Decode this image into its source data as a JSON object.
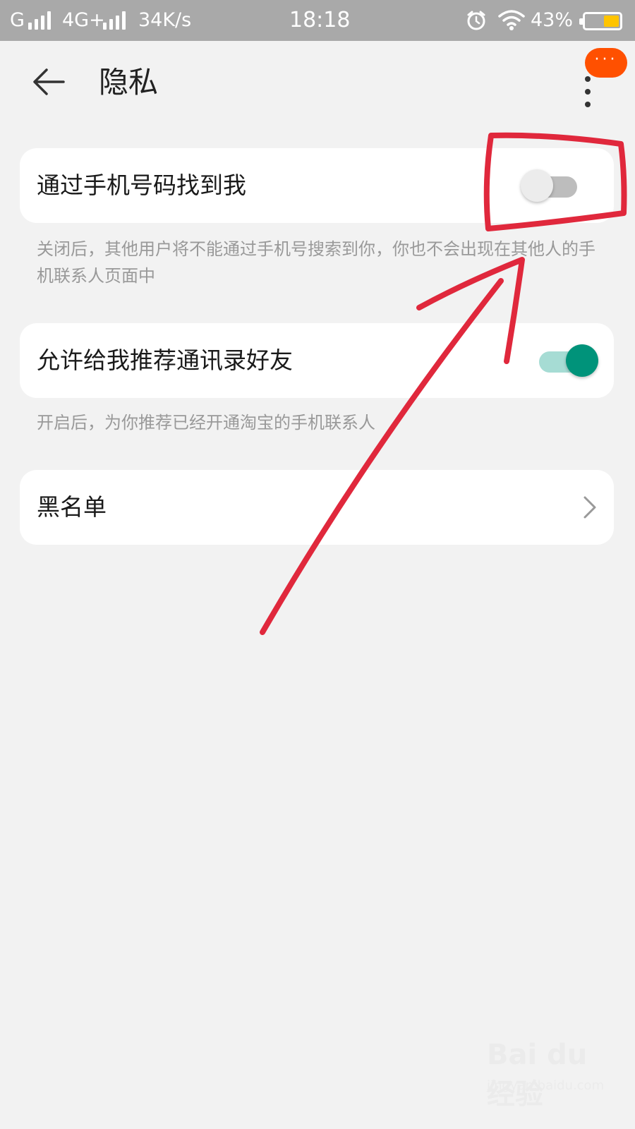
{
  "status_bar": {
    "carrier1": "G",
    "carrier2": "4G+",
    "speed": "34K/s",
    "time": "18:18",
    "battery_pct": "43%",
    "battery_level": 0.43,
    "icons": [
      "signal-icon",
      "alarm-icon",
      "wifi-icon",
      "battery-icon"
    ]
  },
  "header": {
    "title": "隐私",
    "back_icon": "back-arrow-icon",
    "more_icon": "more-vertical-icon",
    "badge_text": "···",
    "badge_color": "#ff5000"
  },
  "settings": [
    {
      "label": "通过手机号码找到我",
      "toggle": "off",
      "description": "关闭后，其他用户将不能通过手机号搜索到你，你也不会出现在其他人的手机联系人页面中"
    },
    {
      "label": "允许给我推荐通讯录好友",
      "toggle": "on",
      "description": "开启后，为你推荐已经开通淘宝的手机联系人"
    },
    {
      "label": "黑名单",
      "icon": "chevron-right-icon"
    }
  ],
  "colors": {
    "toggle_on": "#00937a",
    "toggle_off": "#bdbdbd",
    "annotation": "#e0283c"
  },
  "watermark": {
    "logo": "Bai du 经验",
    "url": "jingyan.baidu.com"
  }
}
